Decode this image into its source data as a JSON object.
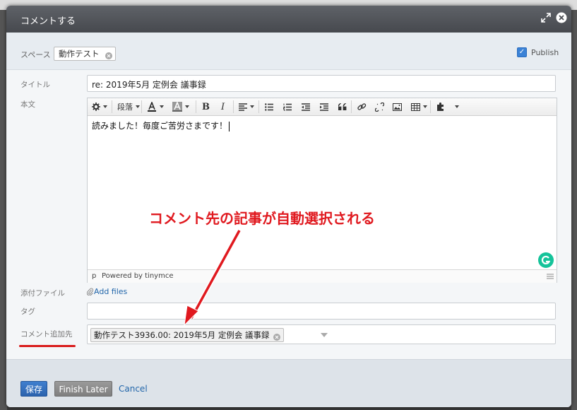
{
  "modal": {
    "title": "コメントする"
  },
  "space": {
    "label": "スペース",
    "tag": "動作テスト",
    "publish_label": "Publish",
    "publish_checked": true
  },
  "fields": {
    "title_label": "タイトル",
    "title_value": "re: 2019年5月 定例会 議事録",
    "body_label": "本文",
    "attach_label": "添付ファイル",
    "attach_link": "Add files",
    "tag_label": "タグ",
    "target_label": "コメント追加先",
    "target_tag": "動作テスト3936.00: 2019年5月 定例会 議事録"
  },
  "editor": {
    "paragraph_label": "段落",
    "content": "読みました！毎度ご苦労さまです！",
    "status_path": "p",
    "status_powered": "Powered by tinymce"
  },
  "annotation": {
    "text": "コメント先の記事が自動選択される",
    "color": "#e0191f"
  },
  "footer": {
    "save_label": "保存",
    "finish_later_label": "Finish Later",
    "cancel_label": "Cancel"
  },
  "colors": {
    "primary_button": "#2c63ad",
    "link": "#2266aa",
    "grammarly": "#15c39a"
  }
}
